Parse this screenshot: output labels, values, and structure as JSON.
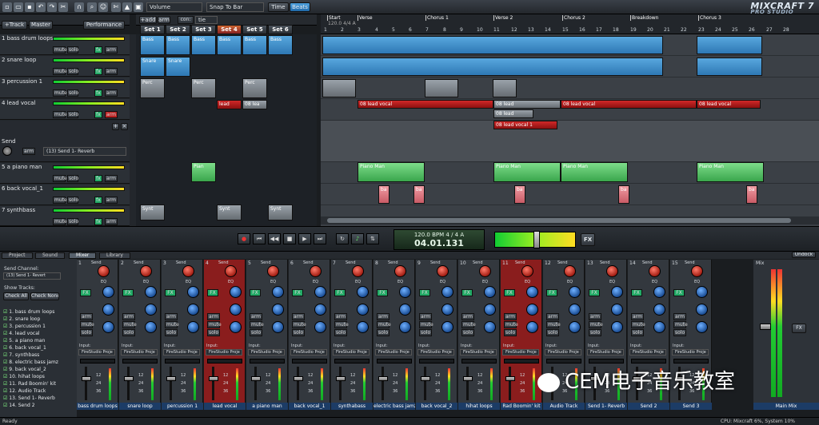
{
  "toolbar": {
    "volume": "Volume",
    "snap": "Snap To Bar",
    "time": "Time",
    "beats": "Beats",
    "logo": "MIXCRAFT 7",
    "logo_sub": "PRO STUDIO"
  },
  "header": {
    "add_track": "+Track",
    "master": "Master",
    "performance": "Performance",
    "add": "+add",
    "arm": "arm",
    "con": "con:",
    "tie": "tie"
  },
  "sets": [
    "Set 1",
    "Set 2",
    "Set 3",
    "Set 4",
    "Set 5",
    "Set 6"
  ],
  "tracks": [
    {
      "name": "1 bass drum loops",
      "buttons": [
        "mute",
        "solo",
        "fx",
        "arm"
      ]
    },
    {
      "name": "2 snare loop",
      "buttons": [
        "mute",
        "solo",
        "fx",
        "arm"
      ]
    },
    {
      "name": "3 percussion 1",
      "buttons": [
        "mute",
        "solo",
        "fx",
        "arm"
      ]
    },
    {
      "name": "4 lead vocal",
      "buttons": [
        "mute",
        "solo",
        "fx",
        "arm"
      ]
    },
    {
      "name": "Send",
      "send_label": "(13) Send 1- Reverb",
      "arm": "arm"
    },
    {
      "name": "5 a piano man",
      "buttons": [
        "mute",
        "solo",
        "fx",
        "arm"
      ]
    },
    {
      "name": "6 back vocal_1",
      "buttons": [
        "mute",
        "solo",
        "fx",
        "arm"
      ]
    },
    {
      "name": "7 synthbass",
      "buttons": [
        "mute",
        "solo",
        "fx",
        "arm"
      ]
    }
  ],
  "performance_clips": {
    "row1": [
      "Bass",
      "Bass",
      "Bass",
      "Bass",
      "Bass",
      "Bass"
    ],
    "row2": [
      "Snare",
      "Snare",
      "",
      "",
      "",
      ""
    ],
    "row3": [
      "Perc",
      "",
      "Perc",
      "",
      "Perc",
      ""
    ],
    "row4": [
      "",
      "",
      "",
      "lead",
      "08 lea",
      ""
    ],
    "row6": [
      "",
      "",
      "Pian",
      ""
    ],
    "row8": [
      "Synt",
      "",
      "",
      "Synt",
      "",
      "Synt"
    ]
  },
  "ruler": {
    "markers": [
      "Start",
      "Verse",
      "Chorus 1",
      "Verse 2",
      "Chorus 2",
      "Breakdown",
      "Chorus 3"
    ],
    "tempo": "120.0 4/4 A",
    "bars": [
      "1",
      "2",
      "3",
      "4",
      "5",
      "6",
      "7",
      "8",
      "9",
      "10",
      "11",
      "12",
      "13",
      "14",
      "15",
      "16",
      "17",
      "18",
      "19",
      "20",
      "21",
      "22",
      "23",
      "24",
      "25",
      "26",
      "27",
      "28"
    ]
  },
  "arrangement_clips": {
    "lead_vocal": [
      "08 lead vocal",
      "08 lead vocal",
      "08 lead vocal",
      "08 lead vocal"
    ],
    "lead_stack": [
      "08 lead",
      "08 lead",
      "08 lead",
      "08 lead vocal 1"
    ],
    "piano": [
      "Piano Man",
      "Piano Man",
      "Piano Man",
      "Piano Man",
      "Piano Man",
      "Piano Man"
    ],
    "back": "ba"
  },
  "transport": {
    "bpm": "120.0 BPM",
    "sig": "4 / 4",
    "key": "A",
    "position": "04.01.131",
    "fx": "FX"
  },
  "tabs": [
    "Project",
    "Sound",
    "Mixer",
    "Library"
  ],
  "undock": "Undock",
  "mixer_left": {
    "send_channel": "Send Channel:",
    "send_value": "(13) Send 1- Revert",
    "show_tracks": "Show Tracks:",
    "check_all": "Check All",
    "check_none": "Check None",
    "list": [
      "1. bass drum loops",
      "2. snare loop",
      "3. percussion 1",
      "4. lead vocal",
      "5. a piano man",
      "6. back vocal_1",
      "7. synthbass",
      "8. electric bass jamz",
      "9. back vocal_2",
      "10. hihat loops",
      "11. Rad Boomin' kit",
      "12. Audio Track",
      "13. Send 1- Reverb",
      "14. Send 2"
    ]
  },
  "strips": [
    "bass drum loops",
    "snare loop",
    "percussion 1",
    "lead vocal",
    "a piano man",
    "back vocal_1",
    "synthabass",
    "electric bass jamz",
    "back vocal_2",
    "hihat loops",
    "Rad Boomin' kit",
    "Audio Track",
    "Send 1- Reverb",
    "Send 2",
    "Send 3",
    "Send 4"
  ],
  "strip_nums": [
    "1",
    "2",
    "3",
    "4",
    "5",
    "6",
    "7",
    "8",
    "9",
    "10",
    "11",
    "12",
    "13",
    "14",
    "15",
    "16"
  ],
  "strip_labels": {
    "send": "Send",
    "eq": "EQ",
    "hi": "Hi",
    "mid": "Mid",
    "lo": "Lo",
    "fx": "FX",
    "arm": "arm",
    "mute": "mute",
    "solo": "solo",
    "input": "Input:",
    "input_val": "FireStudio Proje",
    "db": [
      "12",
      "24",
      "36"
    ]
  },
  "main_mix": {
    "label": "Mix",
    "name": "Main Mix",
    "fx": "FX"
  },
  "watermark": "CEM电子音乐教室",
  "status": {
    "left": "Ready",
    "right": "CPU: Mixcraft 6%, System 10%"
  },
  "colors": {
    "clip_blue": "#2e78b4",
    "clip_red": "#8c1010",
    "clip_green": "#3aa64c",
    "strip_name": "#1c3c66",
    "selected_strip": "#8a1d1d"
  }
}
